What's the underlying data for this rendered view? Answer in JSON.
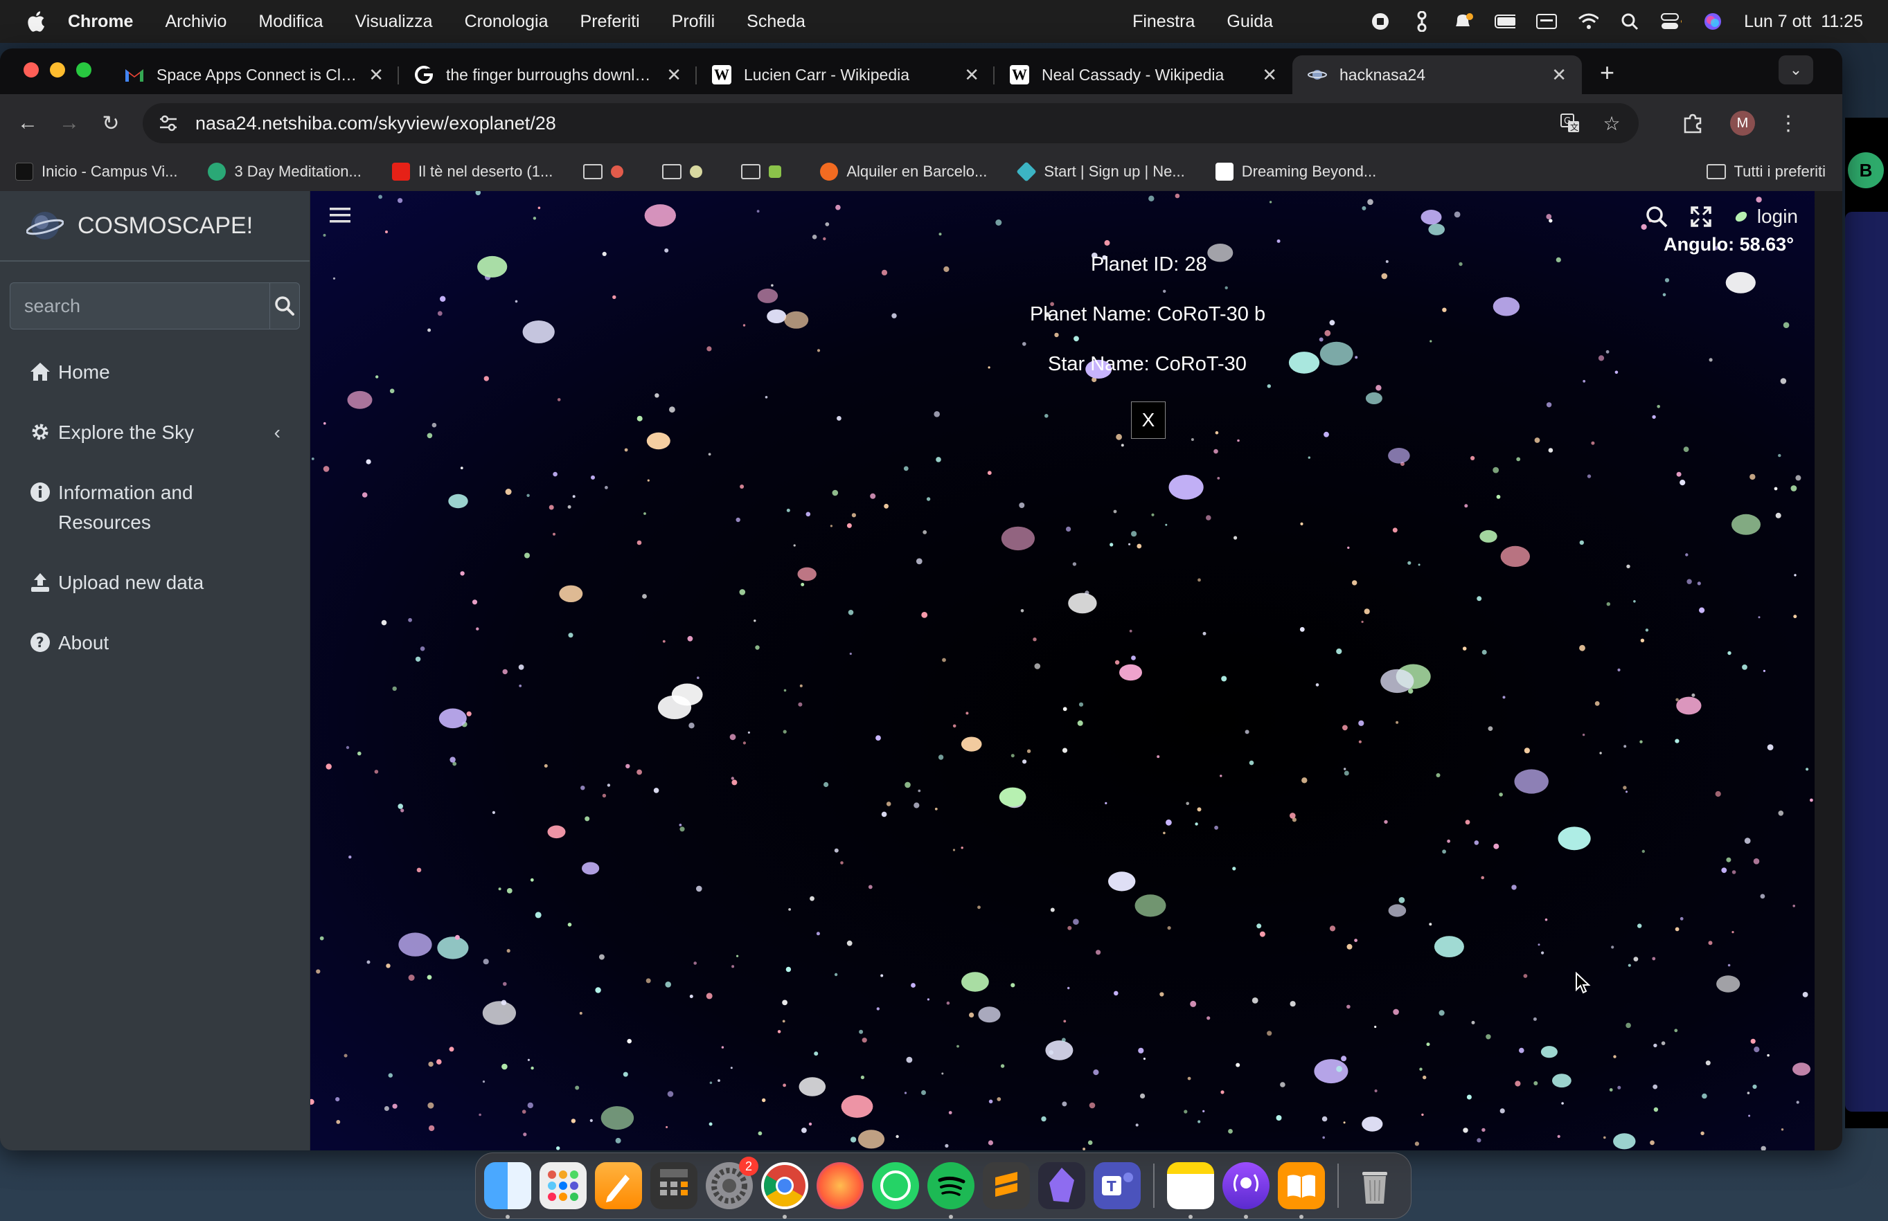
{
  "menubar": {
    "app": "Chrome",
    "items": [
      "Archivio",
      "Modifica",
      "Visualizza",
      "Cronologia",
      "Preferiti",
      "Profili",
      "Scheda"
    ],
    "right_items": [
      "Finestra",
      "Guida"
    ],
    "datetime": "Lun 7 ott  11:25"
  },
  "tabs": [
    {
      "title": "Space Apps Connect is Closing",
      "icon": "gmail-icon"
    },
    {
      "title": "the finger burroughs download",
      "icon": "google-icon"
    },
    {
      "title": "Lucien Carr - Wikipedia",
      "icon": "wikipedia-icon"
    },
    {
      "title": "Neal Cassady - Wikipedia",
      "icon": "wikipedia-icon"
    },
    {
      "title": "hacknasa24",
      "icon": "site-icon",
      "active": true
    }
  ],
  "omnibox": {
    "url": "nasa24.netshiba.com/skyview/exoplanet/28"
  },
  "profile_initial": "M",
  "bookmarks": [
    {
      "label": "Inicio - Campus Vi...",
      "color": "#000000"
    },
    {
      "label": "3 Day Meditation...",
      "color": "#2aa876"
    },
    {
      "label": "Il tè nel deserto (1...",
      "color": "#e62117"
    },
    {
      "label": "",
      "folder": true,
      "color": "#e25b4b"
    },
    {
      "label": "",
      "folder": true,
      "color": "#d8d8a0"
    },
    {
      "label": "",
      "folder": true,
      "color": "#8bc34a"
    },
    {
      "label": "Alquiler en Barcelo...",
      "color": "#f26b21"
    },
    {
      "label": "Start | Sign up | Ne...",
      "color": "#3cb4c4"
    },
    {
      "label": "Dreaming Beyond...",
      "color": "#ffffff"
    }
  ],
  "bookmarks_all": "Tutti i preferiti",
  "sidebar": {
    "brand": "COSMOSCAPE!",
    "search_placeholder": "search",
    "items": [
      {
        "label": "Home",
        "icon": "home-icon"
      },
      {
        "label": "Explore the Sky",
        "icon": "gear-icon",
        "chevron": "‹"
      },
      {
        "label": "Information and Resources",
        "icon": "info-icon"
      },
      {
        "label": "Upload new data",
        "icon": "upload-icon"
      },
      {
        "label": "About",
        "icon": "question-icon"
      }
    ]
  },
  "sky": {
    "login": "login",
    "angle": "Angulo: 58.63°",
    "popup": {
      "planet_id": "Planet ID: 28",
      "planet_name": "Planet Name: CoRoT-30 b",
      "star_name": "Star Name: CoRoT-30",
      "close_label": "X"
    }
  },
  "dock": {
    "apps": [
      "finder",
      "launchpad",
      "pages",
      "calculator",
      "system-settings",
      "chrome",
      "firefox",
      "whatsapp",
      "spotify",
      "sublime-text",
      "obsidian",
      "teams",
      "notes",
      "podcasts",
      "books",
      "trash"
    ],
    "badge": "2",
    "colors": {
      "accent": "#1da1f2"
    }
  }
}
